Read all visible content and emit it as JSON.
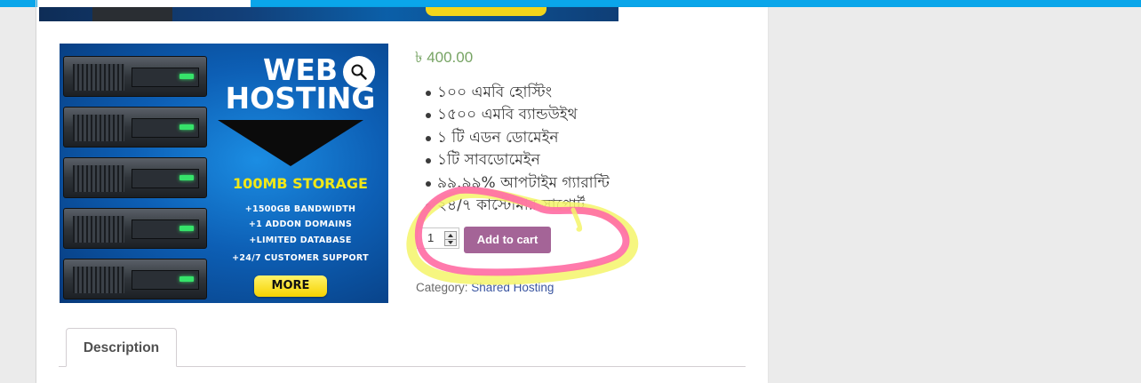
{
  "product": {
    "price": "৳ 400.00",
    "features": [
      "১০০ এমবি হোস্টিং",
      "১৫০০ এমবি ব্যান্ডউইথ",
      "১ টি এডন ডোমেইন",
      "১টি  সাবডোমেইন",
      "৯৯.৯৯% আপটাইম গ্যারান্টি",
      "২৪/৭ কাস্টোমার সাপোর্ট"
    ],
    "quantity": "1",
    "add_to_cart_label": "Add to cart",
    "category_label": "Category:",
    "category_link": "Shared Hosting"
  },
  "banner": {
    "title_line1": "WEB",
    "title_line2": "HOSTING",
    "storage": "100MB STORAGE",
    "lines": [
      "+1500GB BANDWIDTH",
      "+1 ADDON DOMAINS",
      "+LIMITED DATABASE",
      "+24/7 CUSTOMER SUPPORT"
    ],
    "more_label": "MORE"
  },
  "tabs": {
    "description_label": "Description"
  },
  "icons": {
    "zoom": "magnifier-icon",
    "spin": "spinner-arrows-icon"
  },
  "colors": {
    "accent_topbar": "#0aa6ea",
    "price": "#77a464",
    "button": "#a46497",
    "annotation_pink": "#ff6fa5",
    "annotation_yellow": "#f5f56a"
  }
}
